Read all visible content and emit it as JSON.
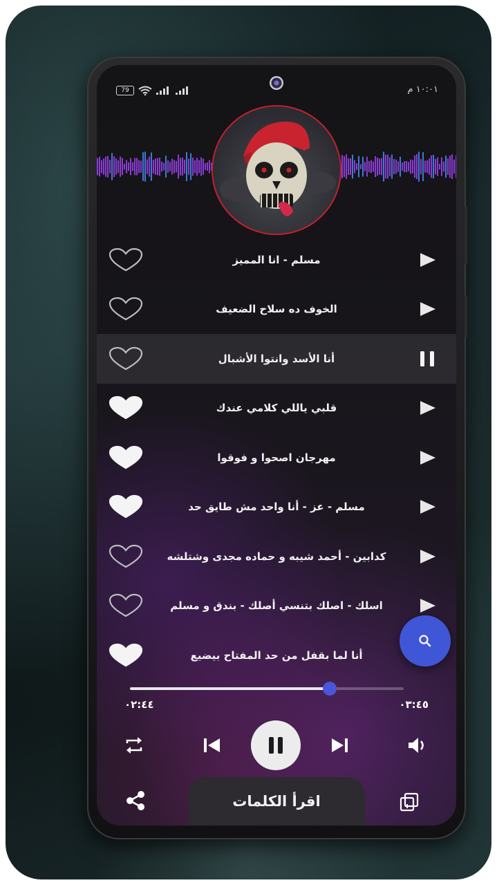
{
  "status_bar": {
    "battery": "79",
    "time": "١٠:٠١ م"
  },
  "colors": {
    "accent": "#3f57d6",
    "album_ring": "#c2202e",
    "wave": "#8a3dd6"
  },
  "tracks": [
    {
      "title": "مسلم - انا المميز",
      "favorite": false,
      "playing": false
    },
    {
      "title": "الخوف ده سلاح الضعيف",
      "favorite": false,
      "playing": false
    },
    {
      "title": "أنا الأسد وانتوا الأشبال",
      "favorite": false,
      "playing": true
    },
    {
      "title": "قلبي ياللي كلامي عندك",
      "favorite": true,
      "playing": false
    },
    {
      "title": "مهرجان اصحوا و فوقوا",
      "favorite": true,
      "playing": false
    },
    {
      "title": "مسلم - عز - أنا واحد مش طايق حد",
      "favorite": true,
      "playing": false
    },
    {
      "title": "كدابين - أحمد شيبه و حماده مجدى وشتلشه",
      "favorite": false,
      "playing": false
    },
    {
      "title": "اسلك - اصلك بتنسي أصلك - بندق و مسلم",
      "favorite": false,
      "playing": false
    },
    {
      "title": "أنا لما بقفل من حد المفتاح بيضيع",
      "favorite": true,
      "playing": false
    }
  ],
  "player": {
    "elapsed": "٠٢:٤٤",
    "duration": "٠٣:٤٥",
    "progress": 0.73,
    "state": "playing"
  },
  "icons": {
    "search": "search-icon",
    "repeat": "repeat-icon",
    "previous": "skip-previous-icon",
    "pause": "pause-icon",
    "next": "skip-next-icon",
    "volume": "volume-icon",
    "share": "share-icon",
    "copy": "copy-icon"
  },
  "bottom": {
    "lyrics_label": "اقرأ الكلمات"
  }
}
